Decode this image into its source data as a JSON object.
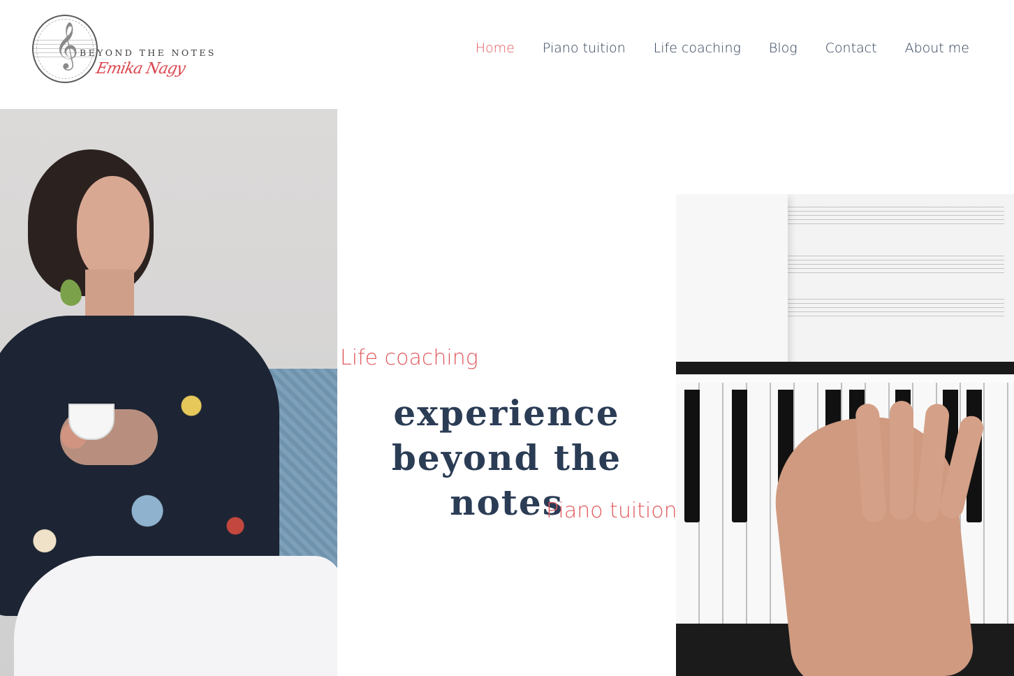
{
  "brand": {
    "name": "BEYOND THE NOTES",
    "signature": "Emika Nagy"
  },
  "nav": {
    "items": [
      {
        "label": "Home",
        "active": true
      },
      {
        "label": "Piano tuition",
        "active": false
      },
      {
        "label": "Life coaching",
        "active": false
      },
      {
        "label": "Blog",
        "active": false
      },
      {
        "label": "Contact",
        "active": false
      },
      {
        "label": "About me",
        "active": false
      }
    ]
  },
  "hero": {
    "kicker_top": "Life coaching",
    "title_line_1": "experience",
    "title_line_2": "beyond the notes",
    "kicker_bottom": "Piano tuition"
  },
  "colors": {
    "accent": "#e05a5e",
    "text": "#2b3c55",
    "background": "#ffffff"
  },
  "icons": {
    "logo": "treble-clef-logo-icon"
  }
}
